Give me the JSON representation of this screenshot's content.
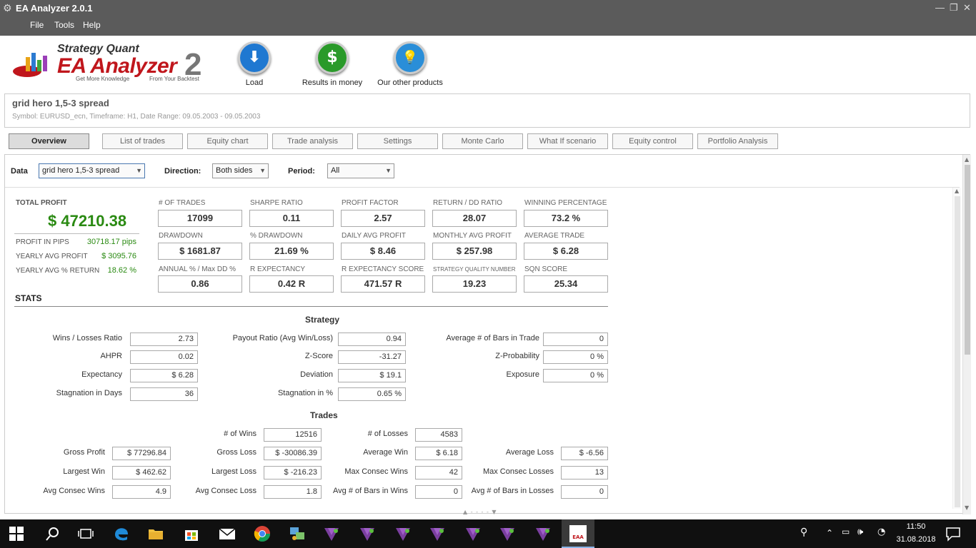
{
  "window": {
    "title": "EA Analyzer 2.0.1",
    "minimize": "—",
    "restore": "❐",
    "close": "✕"
  },
  "menu": {
    "file": "File",
    "tools": "Tools",
    "help": "Help"
  },
  "logo": {
    "top": "Strategy Quant",
    "main": "EA Analyzer",
    "version": "2",
    "tagline_left": "Get More Knowledge",
    "tagline_right": "From Your Backtest"
  },
  "toolbar": {
    "load": "Load",
    "results": "Results in money",
    "products": "Our other products",
    "load_glyph": "⬇",
    "results_glyph": "$",
    "products_glyph": "💡"
  },
  "strategy": {
    "name": "grid hero 1,5-3 spread",
    "description": "Symbol: EURUSD_ecn, Timeframe: H1, Date Range: 09.05.2003 - 09.05.2003"
  },
  "tabs": [
    {
      "label": "Overview"
    },
    {
      "label": "List of trades"
    },
    {
      "label": "Equity chart"
    },
    {
      "label": "Trade analysis"
    },
    {
      "label": "Settings"
    },
    {
      "label": "Monte Carlo"
    },
    {
      "label": "What If scenario"
    },
    {
      "label": "Equity control"
    },
    {
      "label": "Portfolio Analysis"
    }
  ],
  "filters": {
    "data_label": "Data",
    "data_value": "grid hero 1,5-3 spread",
    "direction_label": "Direction:",
    "direction_value": "Both sides",
    "period_label": "Period:",
    "period_value": "All",
    "arrow": "▼"
  },
  "summary": {
    "total_profit_label": "TOTAL PROFIT",
    "total_profit": "$ 47210.38",
    "pips_label": "PROFIT IN PIPS",
    "pips": "30718.17 pips",
    "yearly_avg_label": "YEARLY AVG PROFIT",
    "yearly_avg": "$ 3095.76",
    "yearly_pct_label": "YEARLY AVG % RETURN",
    "yearly_pct": "18.62 %"
  },
  "kpis": [
    {
      "label": "# OF TRADES",
      "value": "17099"
    },
    {
      "label": "SHARPE RATIO",
      "value": "0.11"
    },
    {
      "label": "PROFIT FACTOR",
      "value": "2.57"
    },
    {
      "label": "RETURN / DD RATIO",
      "value": "28.07"
    },
    {
      "label": "WINNING PERCENTAGE",
      "value": "73.2 %"
    },
    {
      "label": "DRAWDOWN",
      "value": "$ 1681.87"
    },
    {
      "label": "% DRAWDOWN",
      "value": "21.69 %"
    },
    {
      "label": "DAILY AVG PROFIT",
      "value": "$ 8.46"
    },
    {
      "label": "MONTHLY AVG PROFIT",
      "value": "$ 257.98"
    },
    {
      "label": "AVERAGE TRADE",
      "value": "$ 6.28"
    },
    {
      "label": "ANNUAL % / Max DD %",
      "value": "0.86"
    },
    {
      "label": "R EXPECTANCY",
      "value": "0.42 R"
    },
    {
      "label": "R EXPECTANCY SCORE",
      "value": "471.57 R"
    },
    {
      "label": "STRATEGY QUALITY NUMBER",
      "value": "19.23"
    },
    {
      "label": "SQN SCORE",
      "value": "25.34"
    }
  ],
  "stats": {
    "title": "STATS",
    "strategy_title": "Strategy",
    "trades_title": "Trades",
    "strategy_rows": [
      {
        "label": "Wins / Losses Ratio",
        "value": "2.73"
      },
      {
        "label": "AHPR",
        "value": "0.02"
      },
      {
        "label": "Expectancy",
        "value": "$ 6.28"
      },
      {
        "label": "Stagnation in Days",
        "value": "36"
      },
      {
        "label": "Payout Ratio (Avg Win/Loss)",
        "value": "0.94"
      },
      {
        "label": "Z-Score",
        "value": "-31.27"
      },
      {
        "label": "Deviation",
        "value": "$ 19.1"
      },
      {
        "label": "Stagnation in %",
        "value": "0.65 %"
      },
      {
        "label": "Average # of Bars in Trade",
        "value": "0"
      },
      {
        "label": "Z-Probability",
        "value": "0 %"
      },
      {
        "label": "Exposure",
        "value": "0 %"
      }
    ],
    "trade_rows": [
      {
        "label": "# of Wins",
        "value": "12516"
      },
      {
        "label": "# of Losses",
        "value": "4583"
      },
      {
        "label": "Gross Profit",
        "value": "$ 77296.84"
      },
      {
        "label": "Gross Loss",
        "value": "$ -30086.39"
      },
      {
        "label": "Average Win",
        "value": "$ 6.18"
      },
      {
        "label": "Average Loss",
        "value": "$ -6.56"
      },
      {
        "label": "Largest Win",
        "value": "$ 462.62"
      },
      {
        "label": "Largest Loss",
        "value": "$ -216.23"
      },
      {
        "label": "Max Consec Wins",
        "value": "42"
      },
      {
        "label": "Max Consec Losses",
        "value": "13"
      },
      {
        "label": "Avg Consec Wins",
        "value": "4.9"
      },
      {
        "label": "Avg Consec Loss",
        "value": "1.8"
      },
      {
        "label": "Avg # of Bars in Wins",
        "value": "0"
      },
      {
        "label": "Avg # of Bars in Losses",
        "value": "0"
      }
    ]
  },
  "taskbar": {
    "time": "11:50",
    "date": "31.08.2018",
    "app_badge": "EAA"
  },
  "colors": {
    "profit_green": "#2a8a12",
    "title_bar": "#5b5b5b",
    "logo_red": "#c0161c"
  }
}
